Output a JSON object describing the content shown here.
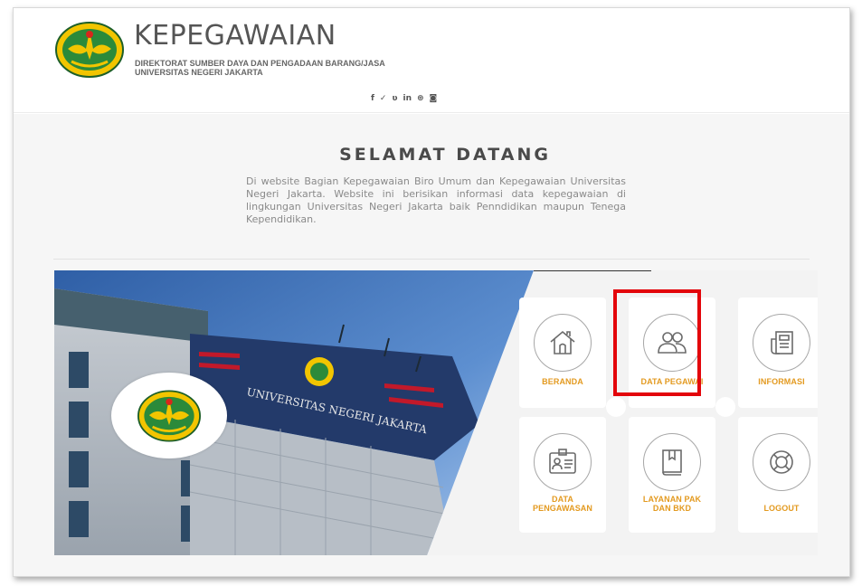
{
  "header": {
    "site_title": "KEPEGAWAIAN",
    "subtitle_line1": "DIREKTORAT SUMBER DAYA DAN PENGADAAN BARANG/JASA",
    "subtitle_line2": "UNIVERSITAS NEGERI JAKARTA",
    "social": [
      "f",
      "✓",
      "ʋ",
      "in",
      "⊛",
      "◙"
    ]
  },
  "welcome": {
    "title": "SELAMAT DATANG",
    "text": "Di website Bagian Kepegawaian Biro Umum dan Kepegawaian Universitas Negeri Jakarta. Website ini berisikan informasi data kepegawaian di lingkungan Universitas Negeri Jakarta baik Penndidikan maupun Tenega Kependidikan."
  },
  "hero": {
    "building_sign": "UNIVERSITAS NEGERI JAKARTA"
  },
  "menu": {
    "beranda": "BERANDA",
    "data_pegawai": "DATA PEGAWAI",
    "informasi": "INFORMASI",
    "data_pengawasan_1": "DATA",
    "data_pengawasan_2": "PENGAWASAN",
    "layanan_1": "LAYANAN PAK",
    "layanan_2": "DAN BKD",
    "logout": "LOGOUT"
  },
  "colors": {
    "accent_orange": "#e39a20",
    "highlight_red": "#e3050b",
    "logo_yellow": "#f2c500",
    "logo_green": "#1f7a2e",
    "sign_navy": "#233a6a"
  }
}
